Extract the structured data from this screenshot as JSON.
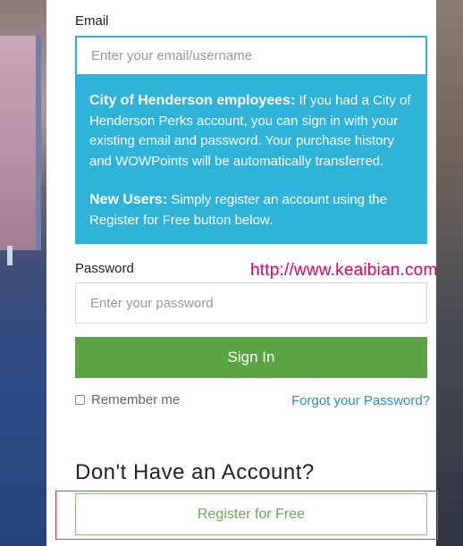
{
  "form": {
    "email_label": "Email",
    "email_placeholder": "Enter your email/username",
    "info": {
      "employees_heading": "City of Henderson employees:",
      "employees_text": " If you had a City of Henderson Perks account, you can sign in with your existing email and password. Your purchase history and WOWPoints will be automatically transferred.",
      "new_users_heading": "New Users:",
      "new_users_text": " Simply register an account using the Register for Free button below."
    },
    "password_label": "Password",
    "password_placeholder": "Enter your password",
    "sign_in_label": "Sign In",
    "remember_label": "Remember me",
    "forgot_label": "Forgot your Password?"
  },
  "register": {
    "heading": "Don't Have an Account?",
    "button_label": "Register for Free"
  },
  "watermark": "http://www.keaibian.com",
  "colors": {
    "info_bg": "#2fb3d8",
    "sign_in_bg": "#5ba443",
    "link": "#2c8fc8",
    "register_text": "#6aaa55",
    "watermark": "#e6005f"
  }
}
